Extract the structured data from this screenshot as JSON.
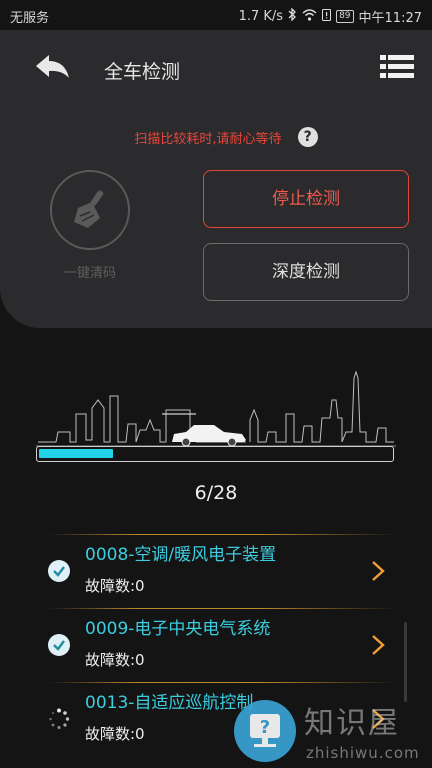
{
  "status_bar": {
    "carrier": "无服务",
    "net_speed": "1.7 K/s",
    "battery": "89",
    "time": "中午11:27"
  },
  "header": {
    "title": "全车检测"
  },
  "hint": {
    "text": "扫描比较耗时,请耐心等待",
    "help_symbol": "?"
  },
  "actions": {
    "clear_codes_label": "一键清码",
    "stop_label": "停止检测",
    "deep_label": "深度检测"
  },
  "progress": {
    "current": 6,
    "total": 28,
    "text": "6/28",
    "fill_fraction": 0.21
  },
  "items": [
    {
      "title": "0008-空调/暖风电子装置",
      "fault": "故障数:0",
      "state": "done"
    },
    {
      "title": "0009-电子中央电气系统",
      "fault": "故障数:0",
      "state": "done"
    },
    {
      "title": "0013-自适应巡航控制",
      "fault": "故障数:0",
      "state": "scanning"
    }
  ],
  "watermark": {
    "logo_symbol": "?",
    "text": "知识屋",
    "sub": "zhishiwu.com"
  },
  "colors": {
    "accent": "#22d3e8",
    "stop": "#e0463c",
    "item_title": "#3ccde0",
    "arrow": "#f0a030"
  },
  "icons": [
    "back-arrow-icon",
    "menu-list-icon",
    "help-icon",
    "broom-icon",
    "check-icon",
    "chevron-right-icon",
    "spinner-icon",
    "car-icon",
    "wifi-icon",
    "bluetooth-icon"
  ]
}
